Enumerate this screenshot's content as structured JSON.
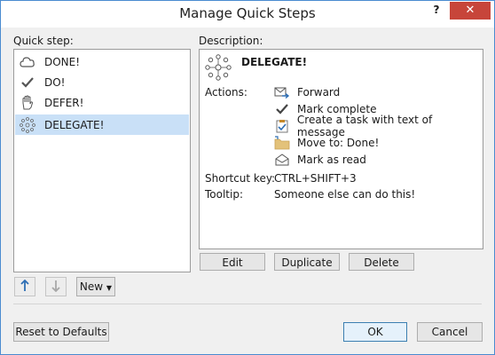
{
  "window": {
    "title": "Manage Quick Steps",
    "help_label": "?",
    "close_label": "✕"
  },
  "quick_step": {
    "label": "Quick step:",
    "items": [
      {
        "label": "DONE!",
        "icon": "cloud-icon"
      },
      {
        "label": "DO!",
        "icon": "checkmark-icon"
      },
      {
        "label": "DEFER!",
        "icon": "hand-icon"
      },
      {
        "label": "DELEGATE!",
        "icon": "delegate-icon",
        "selected": true
      }
    ]
  },
  "description": {
    "label": "Description:",
    "name": "DELEGATE!",
    "actions_label": "Actions:",
    "actions": [
      {
        "label": "Forward",
        "icon": "forward-mail-icon"
      },
      {
        "label": "Mark complete",
        "icon": "checkmark-icon"
      },
      {
        "label": "Create a task with text of message",
        "icon": "task-clipboard-icon"
      },
      {
        "label": "Move to: Done!",
        "icon": "folder-move-icon"
      },
      {
        "label": "Mark as read",
        "icon": "open-envelope-icon"
      }
    ],
    "shortcut_label": "Shortcut key:",
    "shortcut_value": "CTRL+SHIFT+3",
    "tooltip_label": "Tooltip:",
    "tooltip_value": "Someone else can do this!"
  },
  "buttons": {
    "edit": "Edit",
    "duplicate": "Duplicate",
    "delete": "Delete",
    "new": "New",
    "reset": "Reset to Defaults",
    "ok": "OK",
    "cancel": "Cancel"
  },
  "colors": {
    "accent": "#3c7fb1",
    "selection": "#c9e0f7",
    "close": "#c7453a"
  }
}
